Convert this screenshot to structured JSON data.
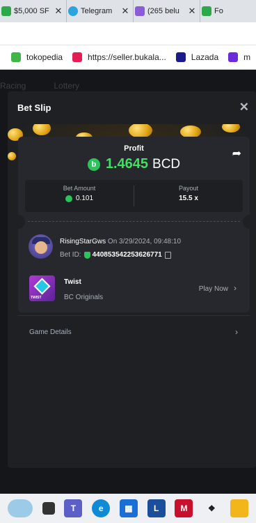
{
  "browser": {
    "tabs": [
      {
        "title": "$5,000 SF",
        "color": "#2ba84a"
      },
      {
        "title": "Telegram",
        "color": "#2aa3de"
      },
      {
        "title": "(265 belu",
        "color": "#8b5cd6"
      },
      {
        "title": "Fo",
        "color": "#2ba84a"
      }
    ],
    "bookmarks": [
      {
        "label": "tokopedia",
        "color": "#42b549"
      },
      {
        "label": "https://seller.bukala...",
        "color": "#e31e52"
      },
      {
        "label": "Lazada",
        "color": "#1a1a8c"
      },
      {
        "label": "m",
        "color": "#6b2bd8"
      }
    ]
  },
  "background_nav": [
    "Racing",
    "Lottery"
  ],
  "bet_slip": {
    "title": "Bet Slip",
    "profit_label": "Profit",
    "profit_value": "1.4645",
    "currency": "BCD",
    "bet_amount_label": "Bet Amount",
    "bet_amount": "0.101",
    "payout_label": "Payout",
    "payout": "15.5 x",
    "username": "RisingStarGws",
    "date_text": "On 3/29/2024, 09:48:10",
    "bet_id_label": "Bet ID:",
    "bet_id": "440853542253626771",
    "game_name": "Twist",
    "game_provider": "BC Originals",
    "play_now": "Play Now",
    "game_details": "Game Details"
  },
  "taskbar": {
    "apps": [
      {
        "name": "search",
        "color": "#9ccbe7"
      },
      {
        "name": "task-view",
        "color": "#333"
      },
      {
        "name": "teams",
        "color": "#5b5fc7"
      },
      {
        "name": "edge",
        "color": "#0f8bd6"
      },
      {
        "name": "store",
        "color": "#1b6ed6"
      },
      {
        "name": "l-app",
        "color": "#1b4f9c"
      },
      {
        "name": "mcafee",
        "color": "#c8102e"
      },
      {
        "name": "dropbox",
        "color": "#1e1e1e"
      },
      {
        "name": "file-explorer",
        "color": "#f2b61a"
      }
    ]
  }
}
